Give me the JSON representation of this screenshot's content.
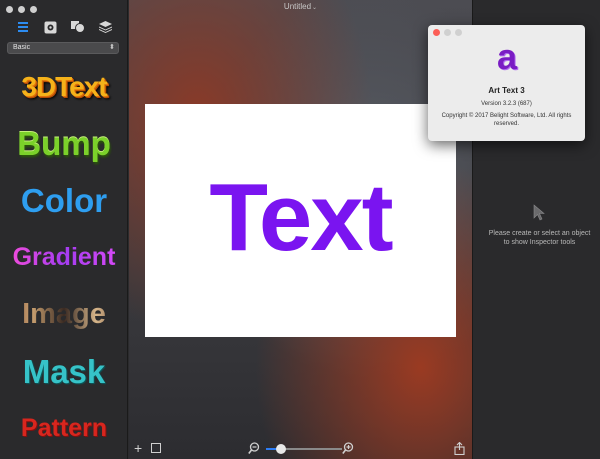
{
  "sidebar": {
    "preset": "Basic",
    "styles": [
      {
        "label": "3DText"
      },
      {
        "label": "Bump"
      },
      {
        "label": "Color"
      },
      {
        "label": "Gradient"
      },
      {
        "label": "Image"
      },
      {
        "label": "Mask"
      },
      {
        "label": "Pattern"
      }
    ]
  },
  "canvas": {
    "document_title": "Untitled",
    "art_text": "Text",
    "text_color": "#7a14f0",
    "zoom_level": 0.2
  },
  "inspector": {
    "message": "Please create or select an object to show Inspector tools"
  },
  "about": {
    "app_name": "Art Text 3",
    "version": "Version 3.2.3 (687)",
    "copyright": "Copyright © 2017 Belight Software, Ltd. All rights reserved.",
    "logo_glyph": "a"
  }
}
